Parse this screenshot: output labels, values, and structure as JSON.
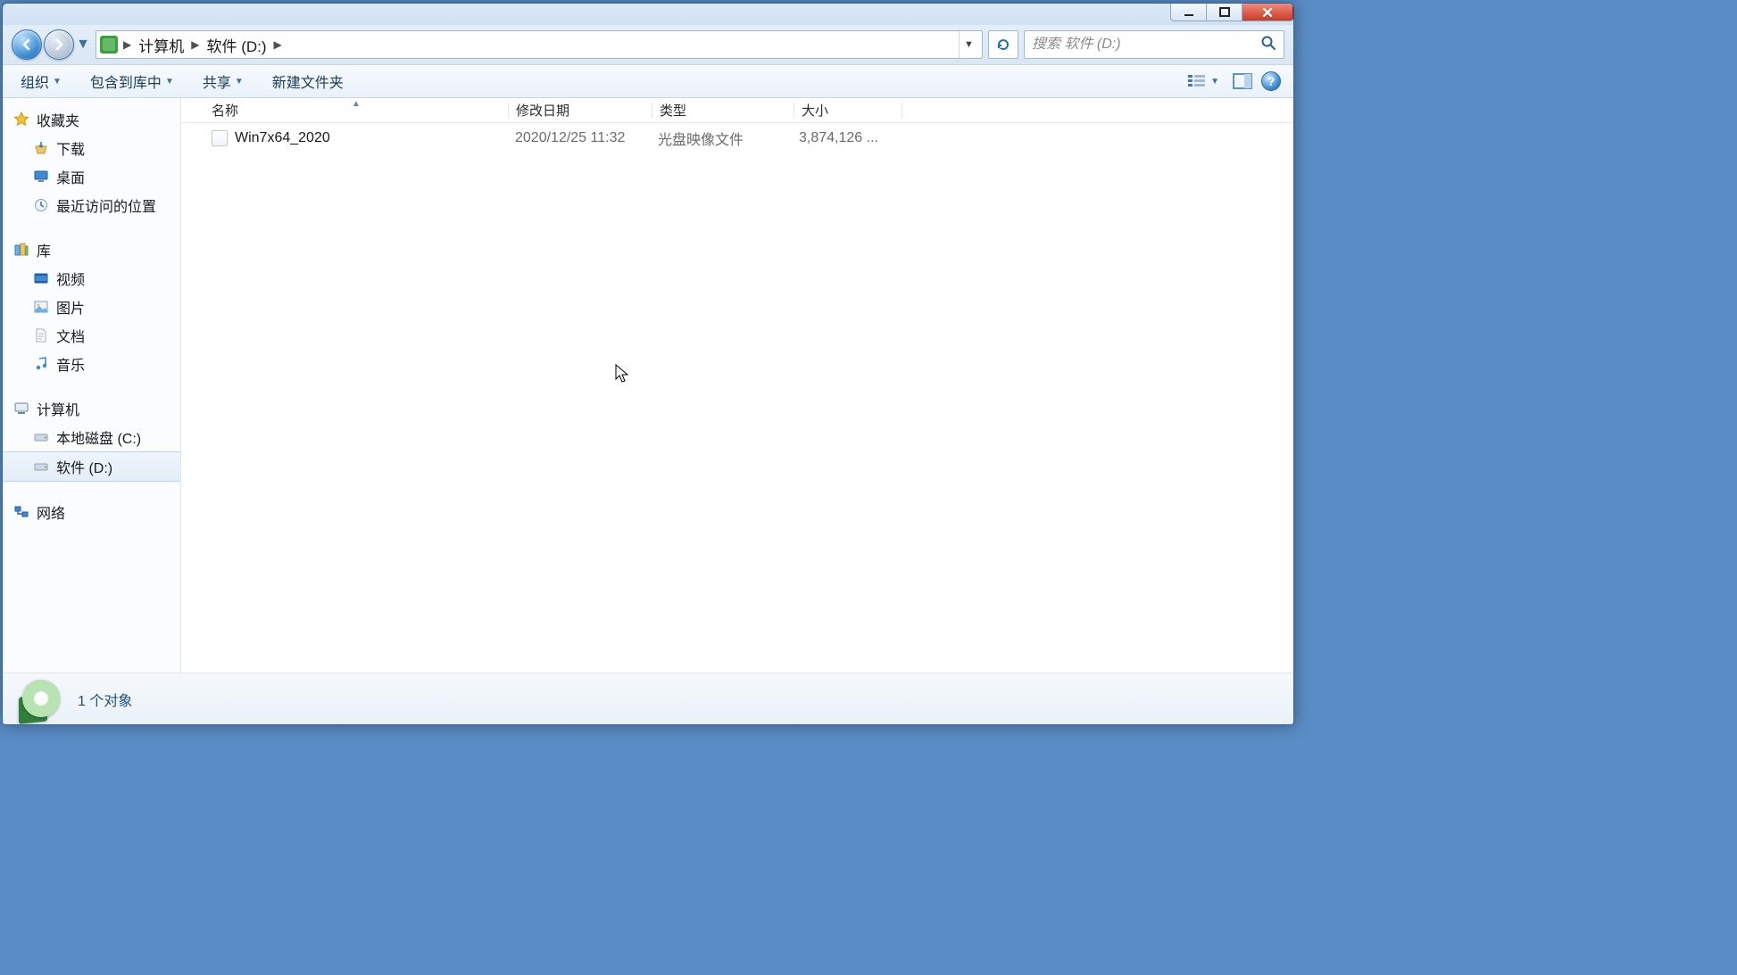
{
  "breadcrumb": {
    "root": "计算机",
    "current": "软件 (D:)"
  },
  "search": {
    "placeholder": "搜索 软件 (D:)"
  },
  "toolbar": {
    "organize": "组织",
    "include": "包含到库中",
    "share": "共享",
    "new_folder": "新建文件夹"
  },
  "columns": {
    "name": "名称",
    "date": "修改日期",
    "type": "类型",
    "size": "大小"
  },
  "sidebar": {
    "favorites": {
      "label": "收藏夹",
      "items": [
        "下载",
        "桌面",
        "最近访问的位置"
      ]
    },
    "libraries": {
      "label": "库",
      "items": [
        "视频",
        "图片",
        "文档",
        "音乐"
      ]
    },
    "computer": {
      "label": "计算机",
      "items": [
        "本地磁盘 (C:)",
        "软件 (D:)"
      ],
      "selected_index": 1
    },
    "network": {
      "label": "网络"
    }
  },
  "files": [
    {
      "name": "Win7x64_2020",
      "date": "2020/12/25 11:32",
      "type": "光盘映像文件",
      "size": "3,874,126 ..."
    }
  ],
  "details": {
    "count_text": "1 个对象"
  }
}
